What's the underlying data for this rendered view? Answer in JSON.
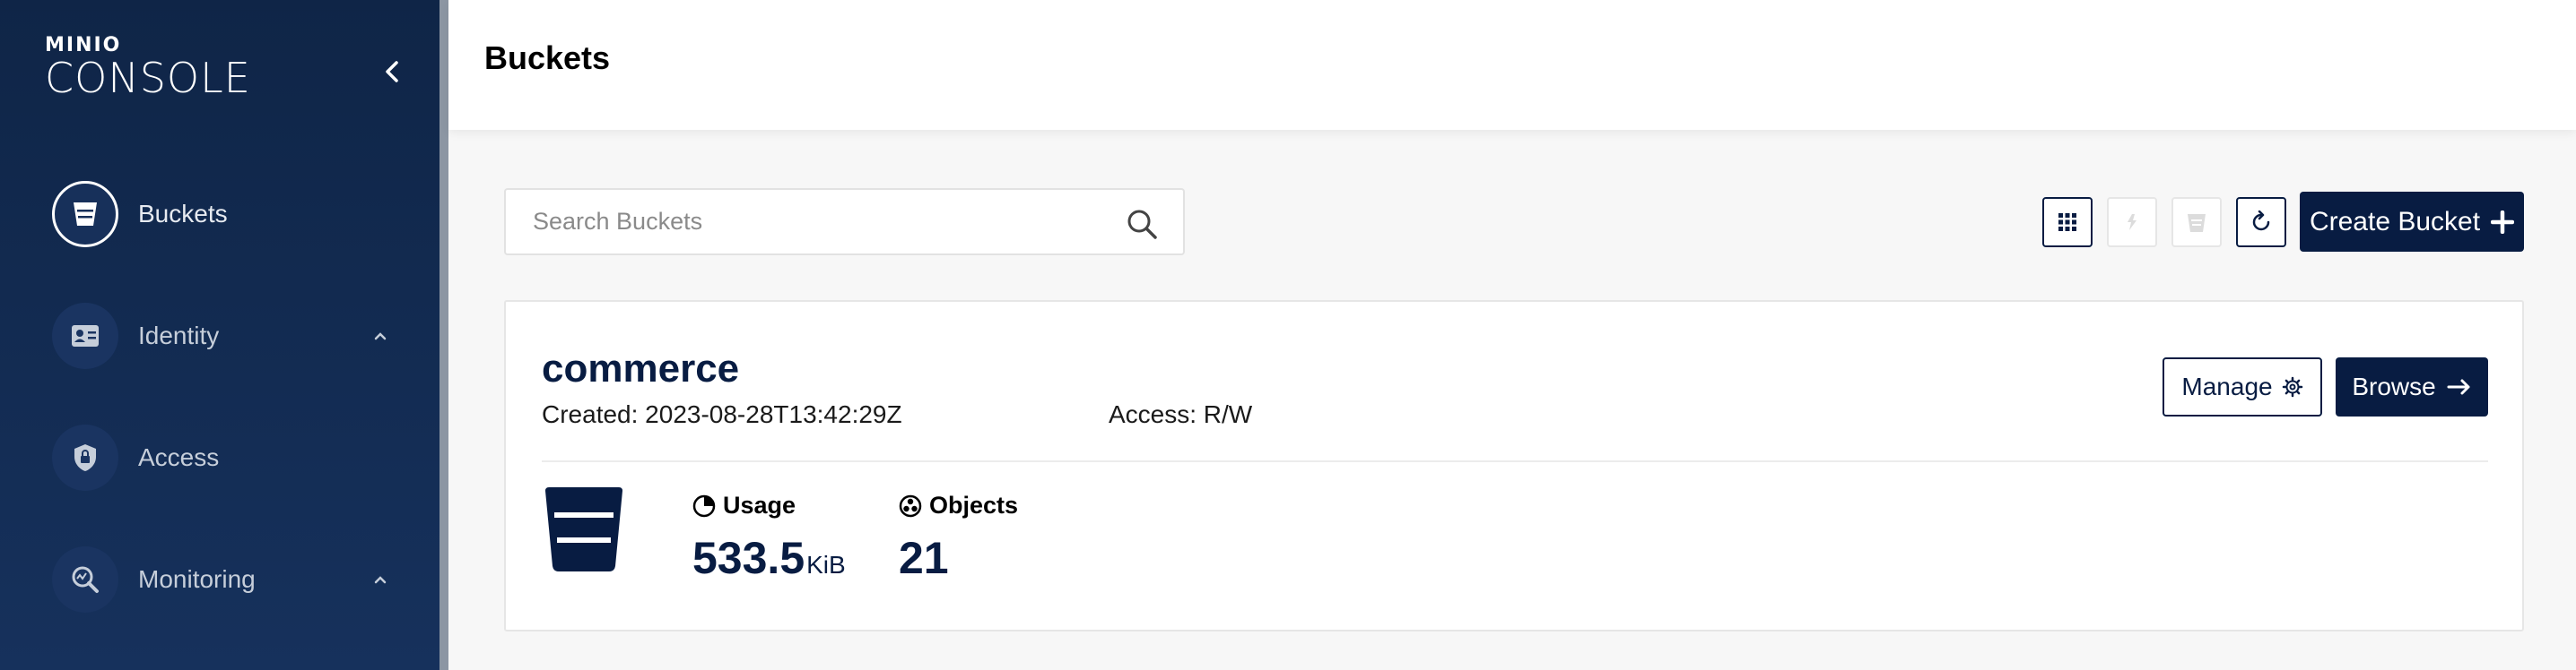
{
  "app": {
    "brand": "MINIO",
    "product": "CONSOLE"
  },
  "sidebar": {
    "collapse_icon": "chevron-left-icon",
    "items": [
      {
        "label": "Buckets",
        "icon": "bucket-icon",
        "active": true
      },
      {
        "label": "Identity",
        "icon": "id-card-icon",
        "expandable": true
      },
      {
        "label": "Access",
        "icon": "shield-lock-icon"
      },
      {
        "label": "Monitoring",
        "icon": "monitor-search-icon",
        "expandable": true
      }
    ]
  },
  "header": {
    "title": "Buckets"
  },
  "toolbar": {
    "search_placeholder": "Search Buckets",
    "create_label": "Create Bucket",
    "buttons": [
      {
        "icon": "grid-icon",
        "enabled": true
      },
      {
        "icon": "replication-icon",
        "enabled": false
      },
      {
        "icon": "delete-bucket-icon",
        "enabled": false
      },
      {
        "icon": "refresh-icon",
        "enabled": true
      }
    ]
  },
  "buckets": [
    {
      "name": "commerce",
      "created": "Created: 2023-08-28T13:42:29Z",
      "access": "Access: R/W",
      "manage_label": "Manage",
      "browse_label": "Browse",
      "usage_label": "Usage",
      "usage_value": "533.5",
      "usage_unit": "KiB",
      "objects_label": "Objects",
      "objects_value": "21"
    }
  ],
  "colors": {
    "sidebar_bg": "#0f2547",
    "primary": "#081c42",
    "page_bg": "#f7f7f7"
  }
}
